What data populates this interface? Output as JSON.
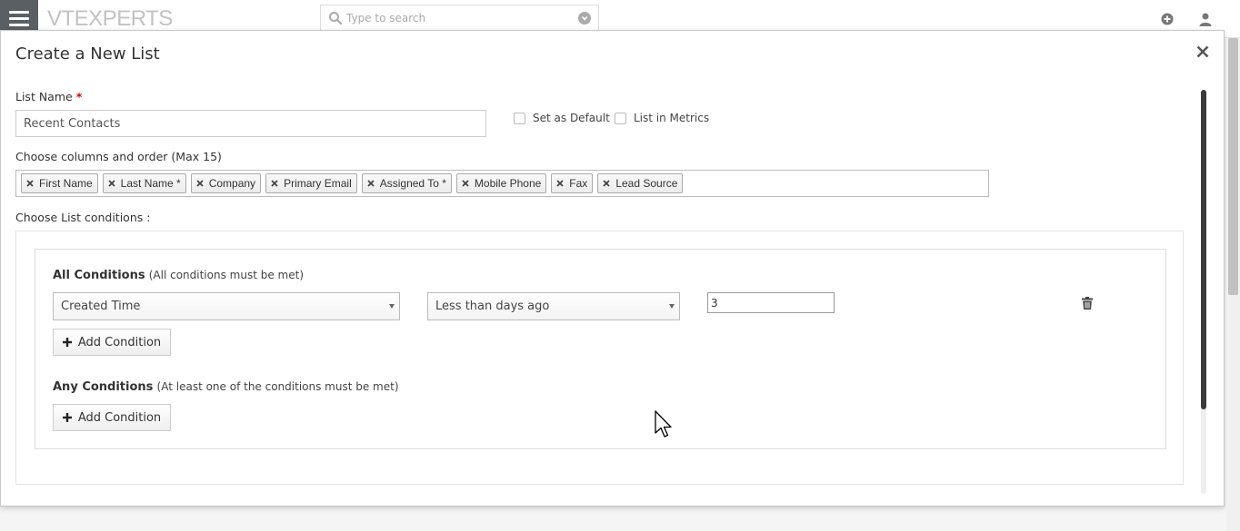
{
  "topbar": {
    "logo": "VTEXPERTS",
    "search_placeholder": "Type to search",
    "icons": [
      "menu-icon",
      "search-icon",
      "chevron-down-icon",
      "plus-circle-icon",
      "user-icon"
    ]
  },
  "modal": {
    "title": "Create a New List",
    "list_name_label": "List Name",
    "required_mark": "*",
    "list_name_value": "Recent Contacts",
    "set_default_label": "Set as Default",
    "list_in_metrics_label": "List in Metrics",
    "columns_label": "Choose columns and order (Max 15)",
    "columns": [
      {
        "label": "First Name"
      },
      {
        "label": "Last Name *"
      },
      {
        "label": "Company"
      },
      {
        "label": "Primary Email"
      },
      {
        "label": "Assigned To *"
      },
      {
        "label": "Mobile Phone"
      },
      {
        "label": "Fax"
      },
      {
        "label": "Lead Source"
      }
    ],
    "conditions_label": "Choose List conditions :",
    "all_conditions": {
      "heading": "All Conditions",
      "subheading": "(All conditions must be met)",
      "field": "Created Time",
      "operator": "Less than days ago",
      "value": "3",
      "add_button": "Add Condition"
    },
    "any_conditions": {
      "heading": "Any Conditions",
      "subheading": "(At least one of the conditions must be met)",
      "add_button": "Add Condition"
    }
  },
  "colors": {
    "menu_bg": "#5a5f63",
    "required": "#dd0000",
    "scroll_thumb": "#3a3a3a"
  }
}
